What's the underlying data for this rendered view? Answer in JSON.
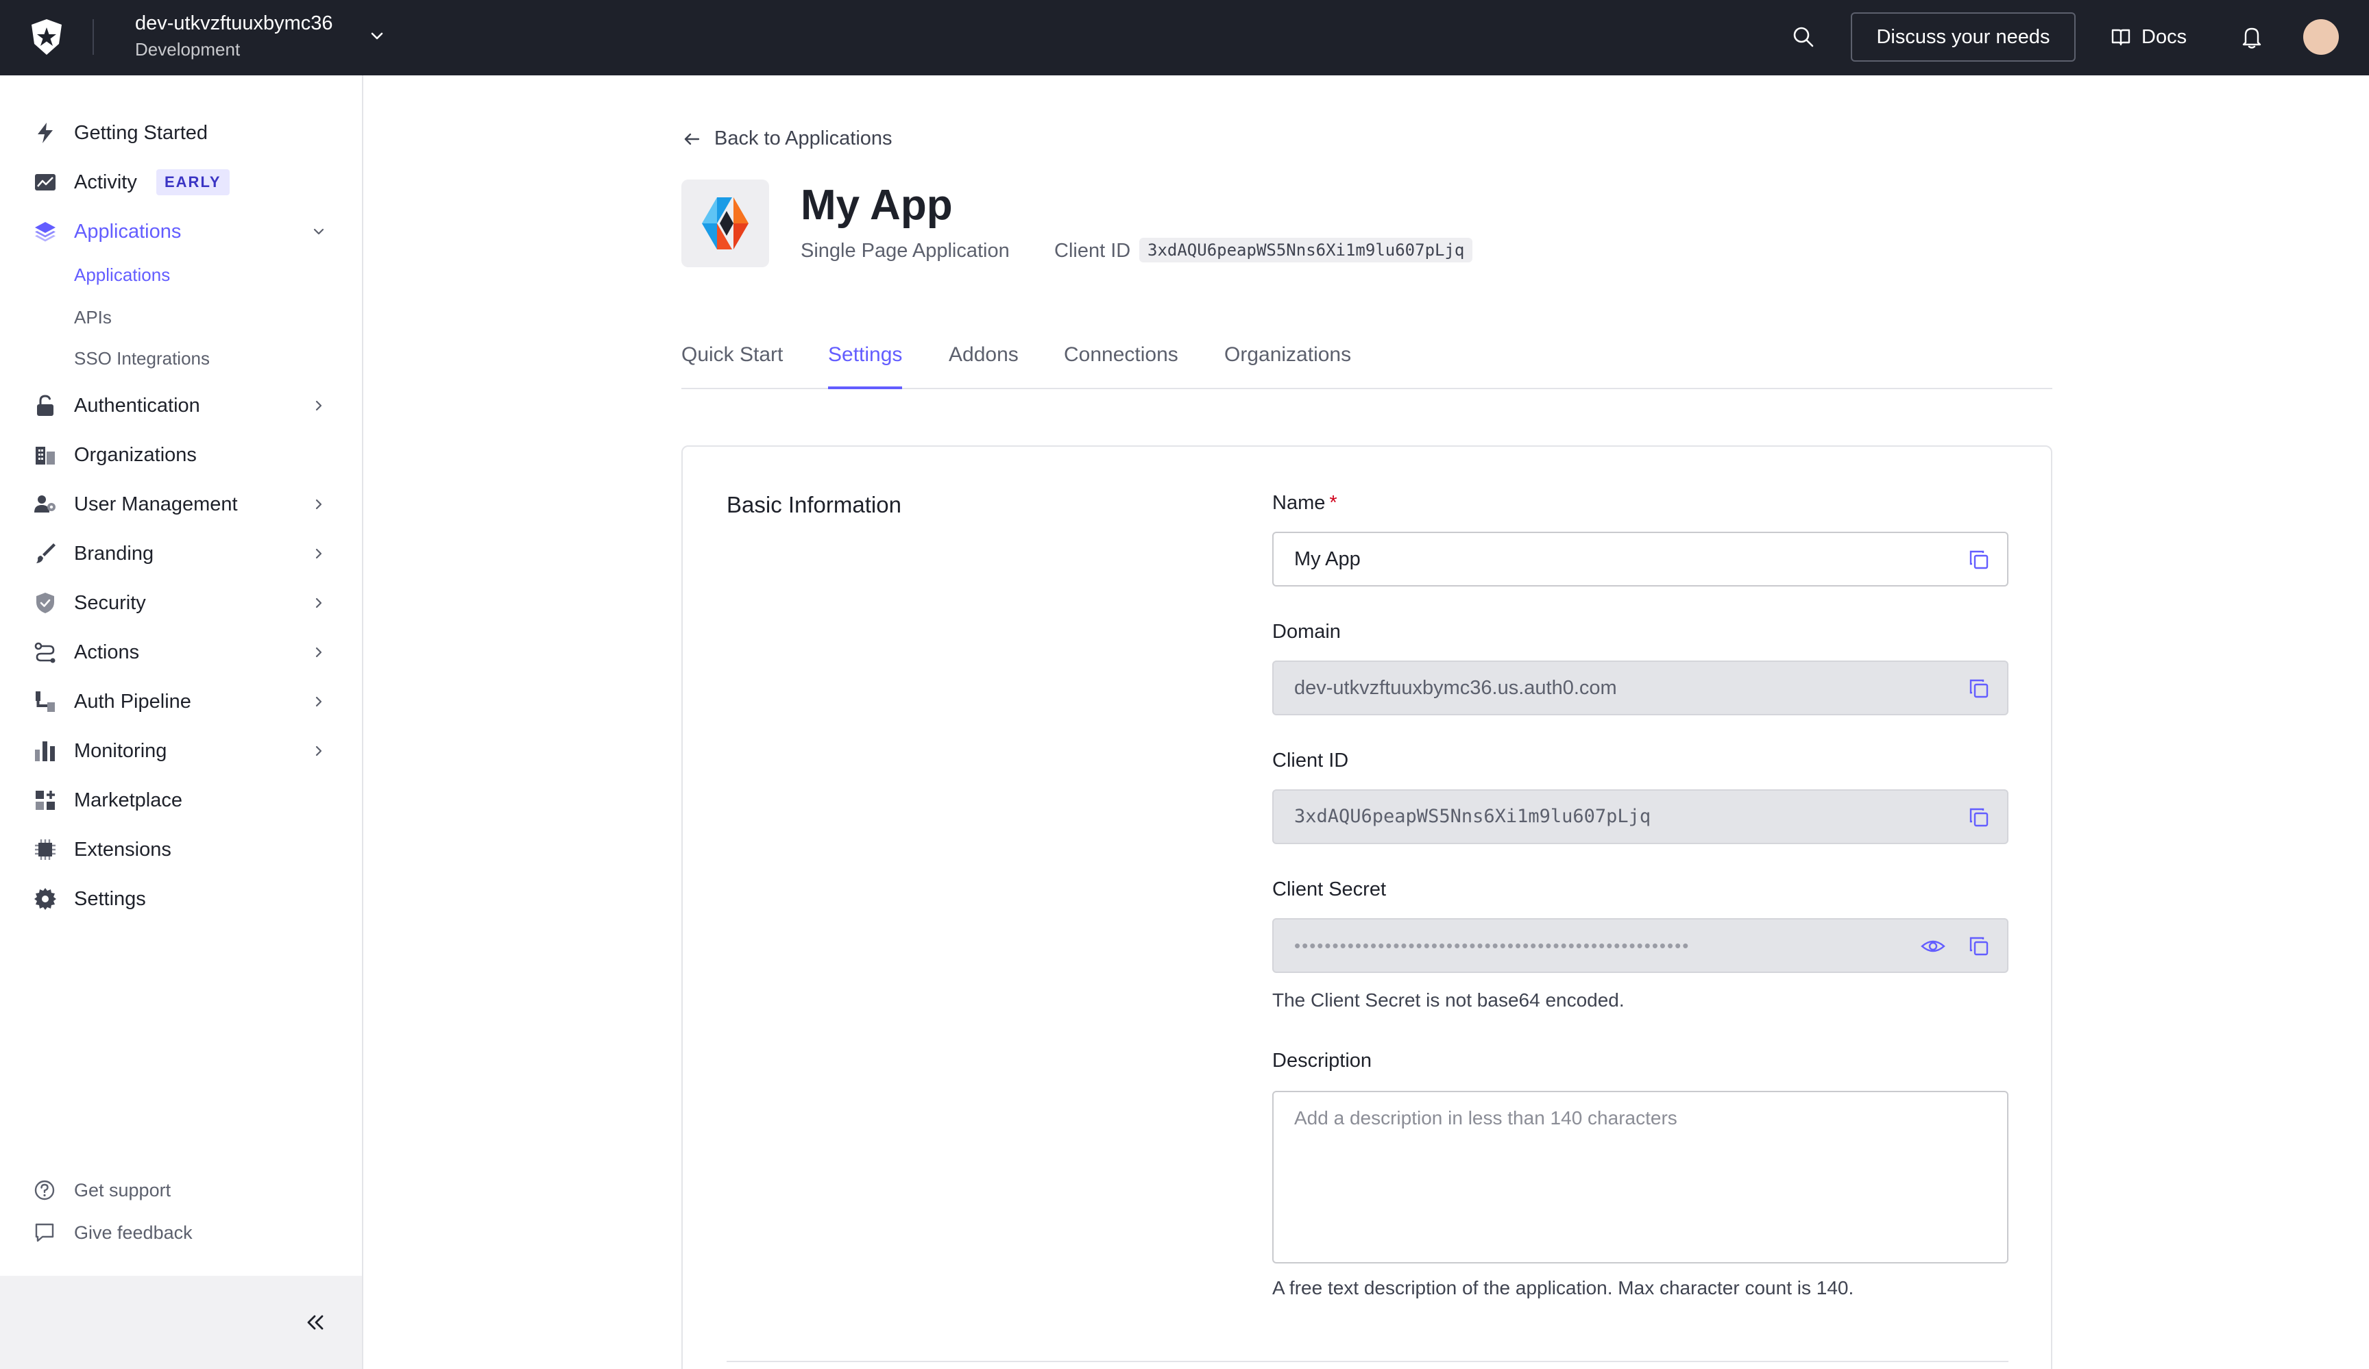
{
  "topbar": {
    "tenant_name": "dev-utkvzftuuxbymc36",
    "tenant_env": "Development",
    "discuss_label": "Discuss your needs",
    "docs_label": "Docs"
  },
  "sidebar": {
    "items": [
      {
        "label": "Getting Started",
        "icon": "lightning-icon"
      },
      {
        "label": "Activity",
        "icon": "activity-chart-icon",
        "badge": "EARLY"
      },
      {
        "label": "Applications",
        "icon": "layers-icon",
        "active": true
      },
      {
        "label": "Authentication",
        "icon": "lock-icon"
      },
      {
        "label": "Organizations",
        "icon": "buildings-icon"
      },
      {
        "label": "User Management",
        "icon": "users-icon"
      },
      {
        "label": "Branding",
        "icon": "brush-icon"
      },
      {
        "label": "Security",
        "icon": "shield-icon"
      },
      {
        "label": "Actions",
        "icon": "actions-flow-icon"
      },
      {
        "label": "Auth Pipeline",
        "icon": "pipeline-icon"
      },
      {
        "label": "Monitoring",
        "icon": "bar-chart-icon"
      },
      {
        "label": "Marketplace",
        "icon": "grid-plus-icon"
      },
      {
        "label": "Extensions",
        "icon": "chip-icon"
      },
      {
        "label": "Settings",
        "icon": "gear-icon"
      }
    ],
    "sub_items": [
      "Applications",
      "APIs",
      "SSO Integrations"
    ],
    "support_label": "Get support",
    "feedback_label": "Give feedback"
  },
  "main": {
    "back_label": "Back to Applications",
    "app_name": "My App",
    "app_type": "Single Page Application",
    "client_id_label": "Client ID",
    "client_id": "3xdAQU6peapWS5Nns6Xi1m9lu607pLjq",
    "tabs": [
      "Quick Start",
      "Settings",
      "Addons",
      "Connections",
      "Organizations"
    ],
    "active_tab": "Settings"
  },
  "form": {
    "section_title": "Basic Information",
    "name_label": "Name",
    "required_mark": "*",
    "name_value": "My App",
    "domain_label": "Domain",
    "domain_value": "dev-utkvzftuuxbymc36.us.auth0.com",
    "client_id_label": "Client ID",
    "client_id_value": "3xdAQU6peapWS5Nns6Xi1m9lu607pLjq",
    "client_secret_label": "Client Secret",
    "client_secret_masked": "••••••••••••••••••••••••••••••••••••••••••••••••••••",
    "client_secret_help": "The Client Secret is not base64 encoded.",
    "description_label": "Description",
    "description_placeholder": "Add a description in less than 140 characters",
    "description_help": "A free text description of the application. Max character count is 140."
  },
  "colors": {
    "accent": "#635dff",
    "topbar": "#1e212a"
  }
}
